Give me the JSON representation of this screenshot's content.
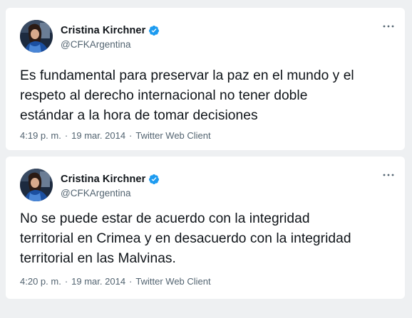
{
  "tweets": [
    {
      "author": {
        "name": "Cristina Kirchner",
        "handle": "@CFKArgentina",
        "verified_icon": "verified-badge-icon",
        "avatar_icon": "avatar-photo"
      },
      "text": "Es fundamental para preservar la paz en el mundo y el\nrespeto al derecho internacional no tener doble\nestándar a la hora de tomar decisiones",
      "time": "4:19 p. m.",
      "separator_1": "·",
      "date": "19 mar. 2014",
      "separator_2": "·",
      "source": "Twitter Web Client",
      "more_icon": "more-options-icon"
    },
    {
      "author": {
        "name": "Cristina Kirchner",
        "handle": "@CFKArgentina",
        "verified_icon": "verified-badge-icon",
        "avatar_icon": "avatar-photo"
      },
      "text": "No se puede estar de acuerdo con la integridad\nterritorial en Crimea y en desacuerdo con la integridad\nterritorial en las Malvinas.",
      "time": "4:20 p. m.",
      "separator_1": "·",
      "date": "19 mar. 2014",
      "separator_2": "·",
      "source": "Twitter Web Client",
      "more_icon": "more-options-icon"
    }
  ],
  "colors": {
    "background": "#eef0f2",
    "card": "#ffffff",
    "text_primary": "#0f1419",
    "text_secondary": "#536471",
    "verified_blue": "#1d9bf0"
  }
}
